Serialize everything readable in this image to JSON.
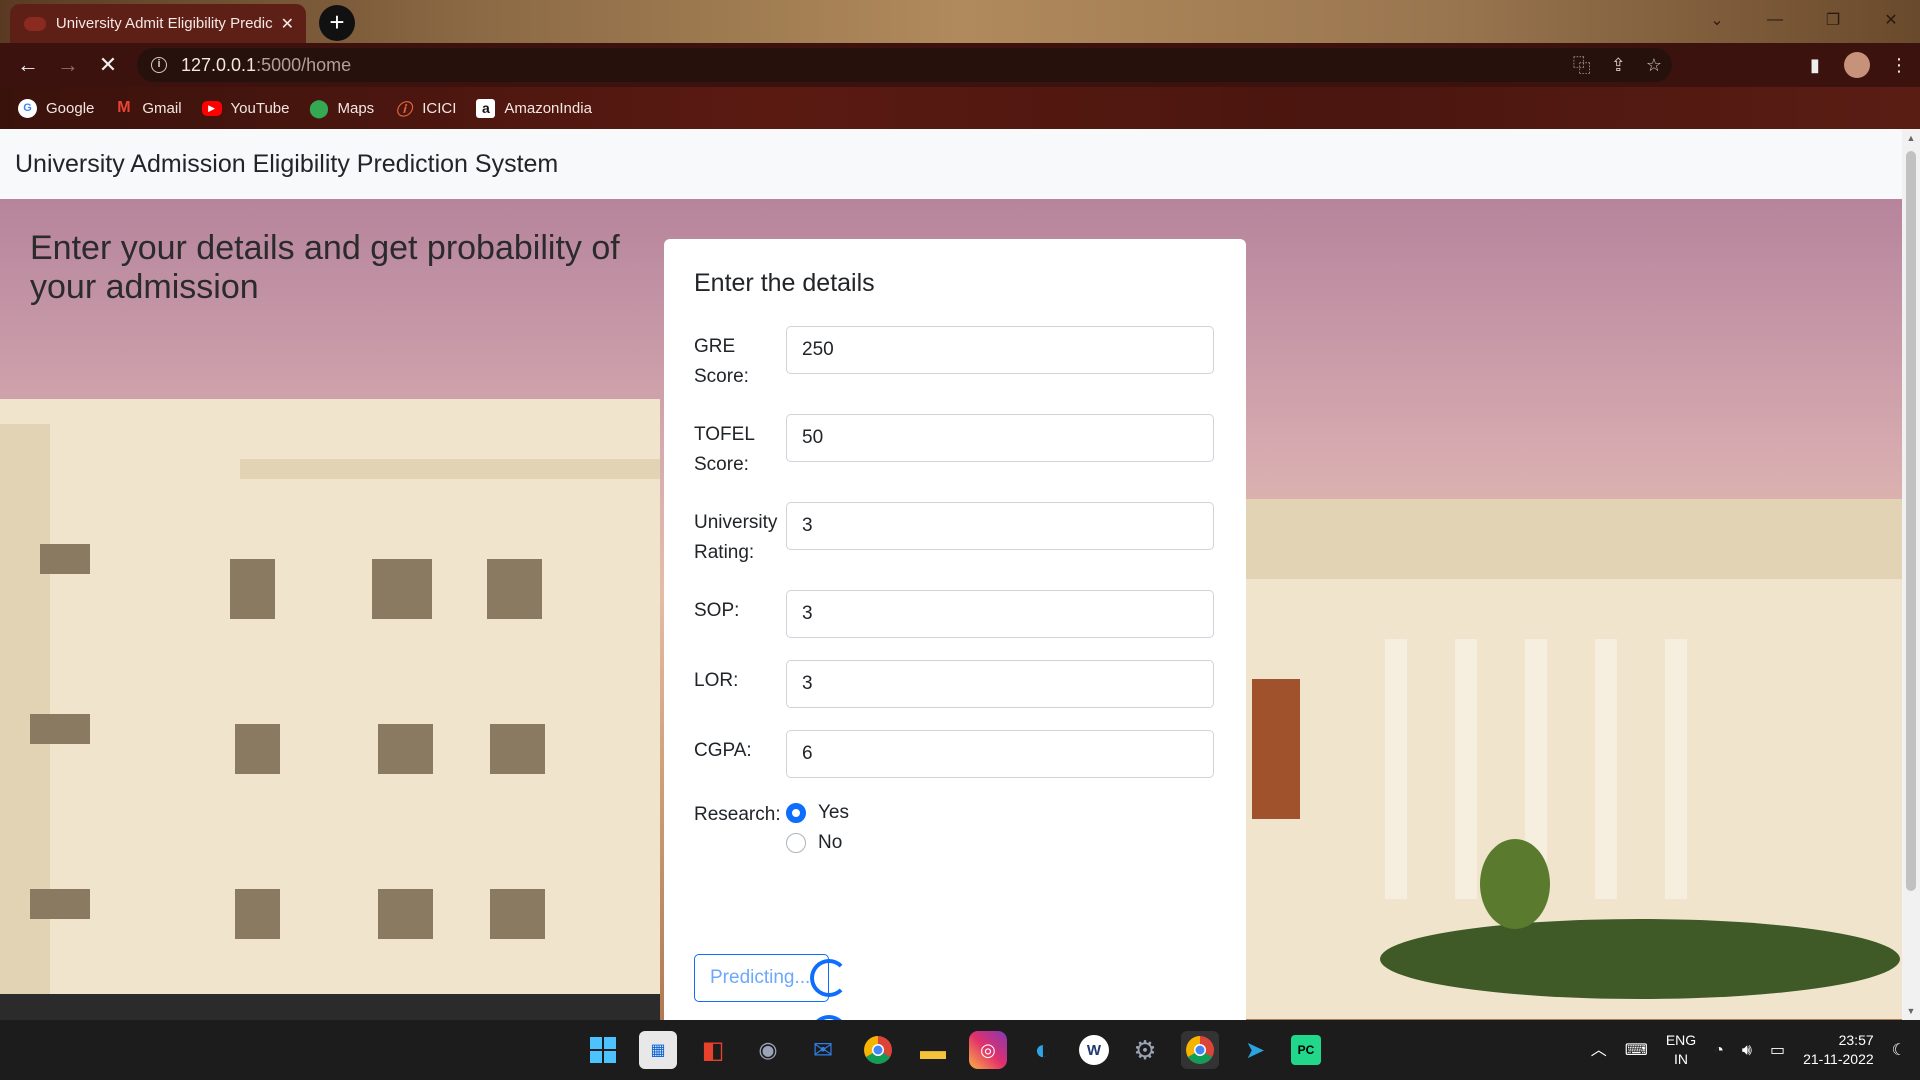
{
  "browser": {
    "tab_title": "University Admit Eligibility Predic",
    "new_tab_symbol": "+",
    "url_host": "127.0.0.1",
    "url_path": ":5000/home",
    "bookmarks": [
      {
        "label": "Google",
        "icon": "google-icon",
        "color": "#ffffff",
        "glyph": "G"
      },
      {
        "label": "Gmail",
        "icon": "gmail-icon",
        "color": "#ea4335",
        "glyph": "M"
      },
      {
        "label": "YouTube",
        "icon": "youtube-icon",
        "color": "#ff0000",
        "glyph": "▶"
      },
      {
        "label": "Maps",
        "icon": "maps-icon",
        "color": "#34a853",
        "glyph": "●"
      },
      {
        "label": "ICICI",
        "icon": "icici-icon",
        "color": "#b02a1e",
        "glyph": "i"
      },
      {
        "label": "AmazonIndia",
        "icon": "amazon-icon",
        "color": "#ffffff",
        "glyph": "a"
      }
    ]
  },
  "page": {
    "brand": "University Admission Eligibility Prediction System",
    "hero_heading": "Enter your details and get probability of your admission",
    "form": {
      "title": "Enter the details",
      "fields": [
        {
          "label": "GRE Score:",
          "value": "250"
        },
        {
          "label": "TOFEL Score:",
          "value": "50"
        },
        {
          "label": "University Rating:",
          "value": "3"
        },
        {
          "label": "SOP:",
          "value": "3"
        },
        {
          "label": "LOR:",
          "value": "3"
        },
        {
          "label": "CGPA:",
          "value": "6"
        }
      ],
      "research_label": "Research:",
      "research_options": [
        "Yes",
        "No"
      ],
      "research_selected": "Yes",
      "submit_label": "Predicting..."
    }
  },
  "taskbar": {
    "lang_top": "ENG",
    "lang_bottom": "IN",
    "time": "23:57",
    "date": "21-11-2022"
  },
  "colors": {
    "accent": "#0d6efd",
    "tab_bg": "#5e1f17",
    "toolbar_bg": "#3b120d"
  }
}
